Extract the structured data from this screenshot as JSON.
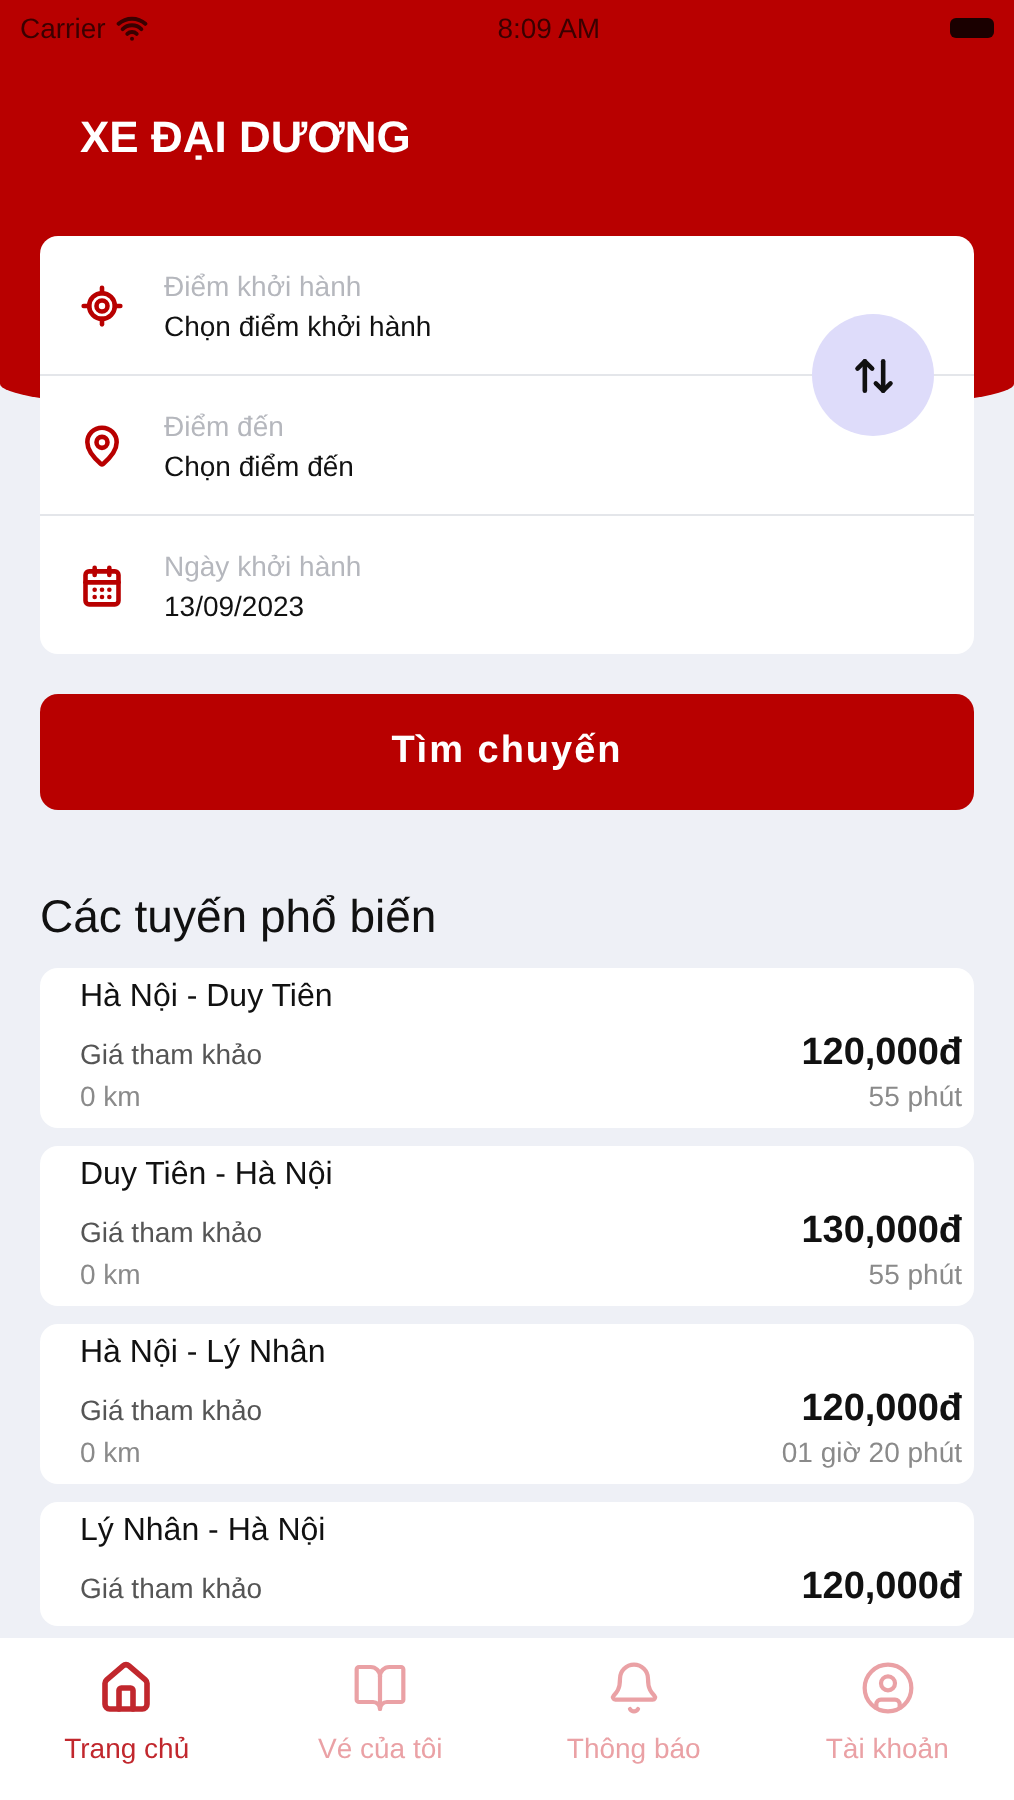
{
  "status_bar": {
    "carrier": "Carrier",
    "time": "8:09 AM"
  },
  "header": {
    "title": "XE ĐẠI DƯƠNG"
  },
  "search_form": {
    "fields": [
      {
        "kind": "origin",
        "label": "Điểm khởi hành",
        "value": "Chọn điểm khởi hành"
      },
      {
        "kind": "destination",
        "label": "Điểm đến",
        "value": "Chọn điểm đến"
      },
      {
        "kind": "date",
        "label": "Ngày khởi hành",
        "value": "13/09/2023"
      }
    ],
    "submit": "Tìm chuyến"
  },
  "popular_routes": {
    "title": "Các tuyến phổ biến",
    "routes": [
      {
        "name": "Hà Nội - Duy Tiên",
        "price_label": "Giá tham khảo",
        "price": "120,000đ",
        "distance": "0 km",
        "duration": "55 phút"
      },
      {
        "name": "Duy Tiên - Hà Nội",
        "price_label": "Giá tham khảo",
        "price": "130,000đ",
        "distance": "0 km",
        "duration": "55 phút"
      },
      {
        "name": "Hà Nội - Lý Nhân",
        "price_label": "Giá tham khảo",
        "price": "120,000đ",
        "distance": "0 km",
        "duration": "01 giờ 20 phút"
      },
      {
        "name": "Lý Nhân - Hà Nội",
        "price_label": "Giá tham khảo",
        "price": "120,000đ"
      }
    ]
  },
  "tab_bar": [
    {
      "kind": "home",
      "label": "Trang chủ",
      "selected": true
    },
    {
      "kind": "tickets",
      "label": "Vé của tôi",
      "selected": false
    },
    {
      "kind": "notifications",
      "label": "Thông báo",
      "selected": false
    },
    {
      "kind": "account",
      "label": "Tài khoản",
      "selected": false
    }
  ]
}
